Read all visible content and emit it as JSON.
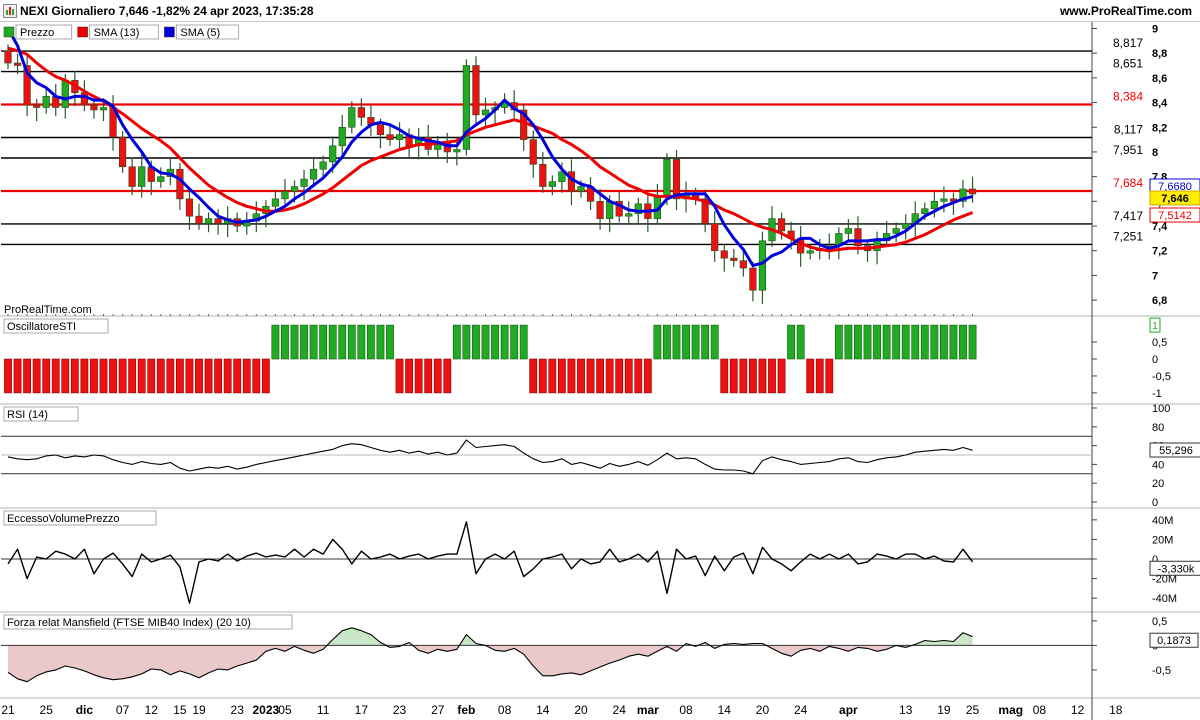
{
  "header": {
    "title": "NEXI Giornaliero 7,646 -1,82% 24 apr 2023, 17:35:28",
    "site": "www.ProRealTime.com"
  },
  "watermark": "ProRealTime.com",
  "panels": {
    "price": {
      "legend": [
        "Prezzo",
        "SMA (13)",
        "SMA (5)"
      ],
      "y_ticks": [
        "9",
        "8,8",
        "8,6",
        "8,4",
        "8,2",
        "8",
        "7,8",
        "7,6",
        "7,4",
        "7,2",
        "7",
        "6,8"
      ],
      "hlines": [
        {
          "value": 8.817,
          "label": "8,817",
          "color": "#000000"
        },
        {
          "value": 8.651,
          "label": "8,651",
          "color": "#000000"
        },
        {
          "value": 8.384,
          "label": "8,384",
          "color": "#ee0000"
        },
        {
          "value": 8.117,
          "label": "8,117",
          "color": "#000000"
        },
        {
          "value": 7.951,
          "label": "7,951",
          "color": "#000000"
        },
        {
          "value": 7.684,
          "label": "7,684",
          "color": "#ee0000"
        },
        {
          "value": 7.417,
          "label": "7,417",
          "color": "#000000"
        },
        {
          "value": 7.251,
          "label": "7,251",
          "color": "#000000"
        }
      ],
      "badges": [
        {
          "value": 7.668,
          "label": "7,6680",
          "bg": "#ffffff",
          "fg": "#0000cc",
          "border": "#0000cc"
        },
        {
          "value": 7.646,
          "label": "7,646",
          "bg": "#ffee00",
          "fg": "#000000",
          "border": "#ccaa00"
        },
        {
          "value": 7.5142,
          "label": "7,5142",
          "bg": "#ffffff",
          "fg": "#ee0000",
          "border": "#ee0000"
        }
      ]
    },
    "sti": {
      "legend": "OscillatoreSTI",
      "y_ticks": [
        "0,5",
        "0",
        "-0,5",
        "-1"
      ],
      "badge": "1"
    },
    "rsi": {
      "legend": "RSI (14)",
      "y_ticks": [
        "100",
        "80",
        "60",
        "40",
        "20",
        "0"
      ],
      "badge": "55,296"
    },
    "evp": {
      "legend": "EccessoVolumePrezzo",
      "y_ticks": [
        "40M",
        "20M",
        "0",
        "-20M",
        "-40M"
      ],
      "badge": "-3,330k"
    },
    "mansfield": {
      "legend": "Forza relat Mansfield (FTSE MIB40 Index) (20 10)",
      "y_ticks": [
        "0,5",
        "0",
        "-0,5"
      ],
      "badge": "0,1873"
    }
  },
  "x_axis": {
    "labels": [
      {
        "text": "21",
        "bar": 0,
        "bold": false
      },
      {
        "text": "25",
        "bar": 4,
        "bold": false
      },
      {
        "text": "dic",
        "bar": 8,
        "bold": true
      },
      {
        "text": "07",
        "bar": 12,
        "bold": false
      },
      {
        "text": "12",
        "bar": 15,
        "bold": false
      },
      {
        "text": "15",
        "bar": 18,
        "bold": false
      },
      {
        "text": "19",
        "bar": 20,
        "bold": false
      },
      {
        "text": "23",
        "bar": 24,
        "bold": false
      },
      {
        "text": "2023",
        "bar": 27,
        "bold": true
      },
      {
        "text": "05",
        "bar": 29,
        "bold": false
      },
      {
        "text": "11",
        "bar": 33,
        "bold": false
      },
      {
        "text": "17",
        "bar": 37,
        "bold": false
      },
      {
        "text": "23",
        "bar": 41,
        "bold": false
      },
      {
        "text": "27",
        "bar": 45,
        "bold": false
      },
      {
        "text": "feb",
        "bar": 48,
        "bold": true
      },
      {
        "text": "08",
        "bar": 52,
        "bold": false
      },
      {
        "text": "14",
        "bar": 56,
        "bold": false
      },
      {
        "text": "20",
        "bar": 60,
        "bold": false
      },
      {
        "text": "24",
        "bar": 64,
        "bold": false
      },
      {
        "text": "mar",
        "bar": 67,
        "bold": true
      },
      {
        "text": "08",
        "bar": 71,
        "bold": false
      },
      {
        "text": "14",
        "bar": 75,
        "bold": false
      },
      {
        "text": "20",
        "bar": 79,
        "bold": false
      },
      {
        "text": "24",
        "bar": 83,
        "bold": false
      },
      {
        "text": "apr",
        "bar": 88,
        "bold": true
      },
      {
        "text": "13",
        "bar": 94,
        "bold": false
      },
      {
        "text": "19",
        "bar": 98,
        "bold": false
      },
      {
        "text": "25",
        "bar": 101,
        "bold": false
      },
      {
        "text": "mag",
        "bar": 105,
        "bold": true
      },
      {
        "text": "08",
        "bar": 108,
        "bold": false
      },
      {
        "text": "12",
        "bar": 112,
        "bold": false
      },
      {
        "text": "18",
        "bar": 116,
        "bold": false
      }
    ]
  },
  "colors": {
    "up": "#22aa22",
    "down": "#ee1111",
    "sma13": "#ee0000",
    "sma5": "#0000dd",
    "grid": "#000000",
    "axis": "#333333"
  },
  "chart_data": {
    "type": "candlestick",
    "symbol": "NEXI",
    "timeframe": "Giornaliero",
    "price_ylim": [
      6.72,
      9.02
    ],
    "closes": [
      8.72,
      8.7,
      8.38,
      8.36,
      8.45,
      8.36,
      8.58,
      8.48,
      8.38,
      8.34,
      8.36,
      8.12,
      7.88,
      7.72,
      7.88,
      7.76,
      7.8,
      7.86,
      7.62,
      7.48,
      7.42,
      7.46,
      7.42,
      7.46,
      7.4,
      7.44,
      7.5,
      7.56,
      7.62,
      7.68,
      7.72,
      7.78,
      7.86,
      7.92,
      8.05,
      8.2,
      8.36,
      8.28,
      8.22,
      8.14,
      8.1,
      8.14,
      8.05,
      8.12,
      8.02,
      8.08,
      8.0,
      8.02,
      8.7,
      8.3,
      8.34,
      8.36,
      8.4,
      8.34,
      8.1,
      7.9,
      7.72,
      7.76,
      7.84,
      7.68,
      7.72,
      7.6,
      7.46,
      7.6,
      7.48,
      7.5,
      7.58,
      7.46,
      7.64,
      7.94,
      7.62,
      7.66,
      7.62,
      7.42,
      7.2,
      7.14,
      7.12,
      7.06,
      6.88,
      7.28,
      7.46,
      7.36,
      7.3,
      7.18,
      7.2,
      7.22,
      7.24,
      7.34,
      7.38,
      7.24,
      7.2,
      7.28,
      7.34,
      7.38,
      7.42,
      7.5,
      7.54,
      7.6,
      7.62,
      7.6,
      7.7,
      7.66
    ],
    "ohlc_note": "highs/lows derived from closes",
    "sma13": [
      8.84,
      8.82,
      8.79,
      8.72,
      8.66,
      8.61,
      8.58,
      8.54,
      8.49,
      8.45,
      8.41,
      8.36,
      8.31,
      8.25,
      8.19,
      8.14,
      8.09,
      8.03,
      7.95,
      7.87,
      7.8,
      7.73,
      7.68,
      7.63,
      7.59,
      7.56,
      7.54,
      7.52,
      7.52,
      7.53,
      7.55,
      7.58,
      7.62,
      7.66,
      7.71,
      7.77,
      7.83,
      7.89,
      7.93,
      7.96,
      7.99,
      8.02,
      8.04,
      8.06,
      8.06,
      8.07,
      8.08,
      8.09,
      8.14,
      8.17,
      8.2,
      8.22,
      8.24,
      8.26,
      8.24,
      8.21,
      8.18,
      8.15,
      8.1,
      8.06,
      8.01,
      7.95,
      7.88,
      7.83,
      7.78,
      7.73,
      7.7,
      7.66,
      7.64,
      7.64,
      7.64,
      7.63,
      7.62,
      7.6,
      7.57,
      7.53,
      7.5,
      7.46,
      7.42,
      7.39,
      7.37,
      7.34,
      7.3,
      7.26,
      7.23,
      7.21,
      7.2,
      7.21,
      7.22,
      7.22,
      7.22,
      7.23,
      7.24,
      7.25,
      7.27,
      7.3,
      7.33,
      7.37,
      7.41,
      7.45,
      7.48,
      7.51
    ],
    "sma5": [
      9.0,
      8.86,
      8.64,
      8.56,
      8.52,
      8.45,
      8.43,
      8.45,
      8.45,
      8.42,
      8.42,
      8.37,
      8.22,
      8.1,
      8.0,
      7.88,
      7.83,
      7.82,
      7.78,
      7.7,
      7.63,
      7.55,
      7.48,
      7.45,
      7.43,
      7.44,
      7.45,
      7.48,
      7.52,
      7.56,
      7.62,
      7.67,
      7.73,
      7.79,
      7.87,
      7.96,
      8.08,
      8.16,
      8.22,
      8.24,
      8.22,
      8.18,
      8.13,
      8.11,
      8.09,
      8.08,
      8.05,
      8.05,
      8.16,
      8.22,
      8.27,
      8.34,
      8.42,
      8.35,
      8.31,
      8.22,
      8.1,
      7.96,
      7.86,
      7.78,
      7.74,
      7.72,
      7.66,
      7.6,
      7.57,
      7.53,
      7.52,
      7.52,
      7.53,
      7.62,
      7.65,
      7.66,
      7.66,
      7.66,
      7.56,
      7.41,
      7.3,
      7.21,
      7.08,
      7.1,
      7.16,
      7.19,
      7.25,
      7.3,
      7.3,
      7.25,
      7.22,
      7.24,
      7.28,
      7.28,
      7.28,
      7.29,
      7.29,
      7.32,
      7.36,
      7.42,
      7.48,
      7.52,
      7.56,
      7.59,
      7.62,
      7.64
    ],
    "sti_sign": [
      -1,
      -1,
      -1,
      -1,
      -1,
      -1,
      -1,
      -1,
      -1,
      -1,
      -1,
      -1,
      -1,
      -1,
      -1,
      -1,
      -1,
      -1,
      -1,
      -1,
      -1,
      -1,
      -1,
      -1,
      -1,
      -1,
      -1,
      -1,
      1,
      1,
      1,
      1,
      1,
      1,
      1,
      1,
      1,
      1,
      1,
      1,
      1,
      -1,
      -1,
      -1,
      -1,
      -1,
      -1,
      1,
      1,
      1,
      1,
      1,
      1,
      1,
      1,
      -1,
      -1,
      -1,
      -1,
      -1,
      -1,
      -1,
      -1,
      -1,
      -1,
      -1,
      -1,
      -1,
      1,
      1,
      1,
      1,
      1,
      1,
      1,
      -1,
      -1,
      -1,
      -1,
      -1,
      -1,
      -1,
      1,
      1,
      -1,
      -1,
      -1,
      1,
      1,
      1,
      1,
      1,
      1,
      1,
      1,
      1,
      1,
      1,
      1,
      1,
      1,
      1
    ],
    "rsi_ylim": [
      0,
      100
    ],
    "rsi_levels": [
      70,
      30
    ],
    "rsi": [
      48,
      46,
      45,
      46,
      49,
      50,
      47,
      49,
      48,
      50,
      49,
      45,
      42,
      40,
      43,
      41,
      40,
      42,
      36,
      33,
      35,
      37,
      36,
      38,
      35,
      37,
      40,
      42,
      44,
      46,
      48,
      50,
      52,
      54,
      56,
      60,
      62,
      61,
      58,
      55,
      53,
      55,
      52,
      54,
      51,
      53,
      50,
      52,
      66,
      58,
      59,
      60,
      61,
      59,
      52,
      46,
      42,
      43,
      46,
      40,
      42,
      39,
      36,
      41,
      38,
      40,
      43,
      39,
      45,
      52,
      46,
      47,
      46,
      40,
      35,
      34,
      34,
      33,
      30,
      44,
      48,
      45,
      43,
      40,
      41,
      42,
      43,
      46,
      47,
      43,
      42,
      45,
      47,
      48,
      50,
      53,
      54,
      55,
      56,
      55,
      58,
      55
    ],
    "evp_ylim": [
      -48000000,
      48000000
    ],
    "evp": [
      -5000000,
      10000000,
      -20000000,
      2000000,
      0,
      8000000,
      5000000,
      0,
      10000000,
      -15000000,
      0,
      6000000,
      -5000000,
      -18000000,
      5000000,
      -3000000,
      0,
      4000000,
      -8000000,
      -45000000,
      -3000000,
      0,
      -2000000,
      5000000,
      -2000000,
      3000000,
      6000000,
      2000000,
      4000000,
      2000000,
      10000000,
      2000000,
      10000000,
      5000000,
      20000000,
      10000000,
      -5000000,
      8000000,
      0,
      2000000,
      5000000,
      0,
      3000000,
      5000000,
      0,
      3000000,
      5000000,
      5000000,
      38000000,
      -15000000,
      0,
      5000000,
      0,
      8000000,
      -18000000,
      -10000000,
      0,
      2000000,
      5000000,
      -10000000,
      0,
      -5000000,
      -3000000,
      10000000,
      -3000000,
      0,
      5000000,
      -3000000,
      8000000,
      -35000000,
      10000000,
      0,
      3000000,
      -17000000,
      3000000,
      -12000000,
      2000000,
      6000000,
      -15000000,
      12000000,
      0,
      -5000000,
      -12000000,
      -3000000,
      5000000,
      0,
      5000000,
      0,
      5000000,
      -5000000,
      -3000000,
      5000000,
      3000000,
      0,
      5000000,
      5000000,
      0,
      3000000,
      -2000000,
      -3000000,
      10000000,
      -3000000
    ],
    "mansfield_ylim": [
      -0.95,
      0.6
    ],
    "mansfield": [
      -0.55,
      -0.68,
      -0.74,
      -0.62,
      -0.54,
      -0.5,
      -0.42,
      -0.46,
      -0.52,
      -0.6,
      -0.66,
      -0.7,
      -0.68,
      -0.64,
      -0.58,
      -0.48,
      -0.5,
      -0.6,
      -0.52,
      -0.58,
      -0.66,
      -0.56,
      -0.48,
      -0.5,
      -0.42,
      -0.36,
      -0.3,
      -0.12,
      -0.06,
      -0.12,
      -0.02,
      -0.1,
      -0.16,
      -0.08,
      0.12,
      0.3,
      0.36,
      0.3,
      0.22,
      0.06,
      -0.04,
      -0.02,
      0.06,
      -0.1,
      -0.16,
      -0.08,
      -0.12,
      -0.08,
      0.22,
      0.04,
      0.0,
      -0.1,
      -0.12,
      -0.06,
      -0.18,
      -0.42,
      -0.62,
      -0.62,
      -0.58,
      -0.56,
      -0.6,
      -0.52,
      -0.44,
      -0.36,
      -0.3,
      -0.22,
      -0.18,
      -0.22,
      -0.12,
      -0.02,
      -0.12,
      0.04,
      -0.02,
      0.06,
      -0.06,
      0.02,
      0.04,
      0.02,
      0.04,
      0.04,
      -0.06,
      -0.16,
      -0.22,
      -0.1,
      -0.06,
      -0.12,
      -0.02,
      -0.06,
      -0.12,
      -0.04,
      -0.06,
      -0.12,
      -0.08,
      0.0,
      -0.04,
      0.02,
      0.1,
      0.08,
      0.1,
      0.08,
      0.26,
      0.18
    ]
  }
}
